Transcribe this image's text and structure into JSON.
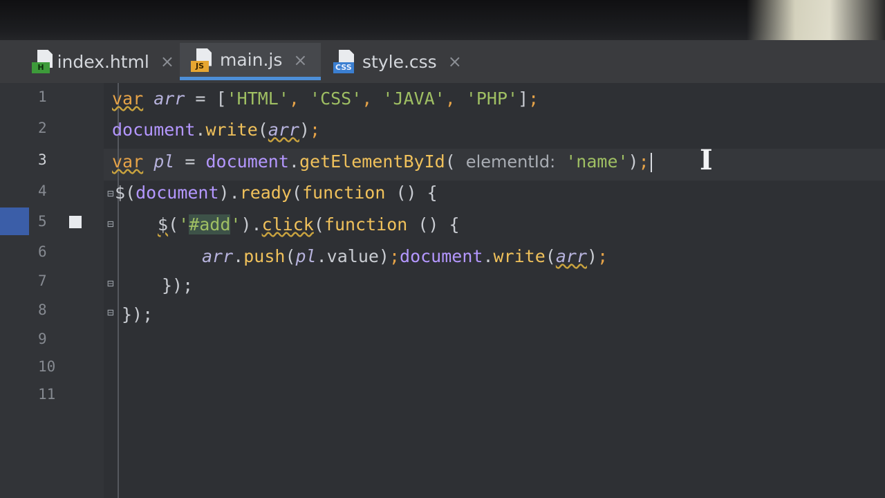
{
  "tabs": [
    {
      "label": "index.html",
      "badge": "H",
      "kind": "html"
    },
    {
      "label": "main.js",
      "badge": "JS",
      "kind": "js"
    },
    {
      "label": "style.css",
      "badge": "CSS",
      "kind": "css"
    }
  ],
  "close_glyph": "×",
  "active_tab": "main.js",
  "line_numbers": [
    "1",
    "2",
    "3",
    "4",
    "5",
    "6",
    "7",
    "8",
    "9",
    "10",
    "11"
  ],
  "current_line": "3",
  "code": {
    "l1": [
      "var",
      " ",
      "arr",
      " = [",
      "'HTML'",
      ", ",
      "'CSS'",
      ", ",
      "'JAVA'",
      ", ",
      "'PHP'",
      "]",
      ";"
    ],
    "l2": [
      "document",
      ".",
      "write",
      "(",
      "arr",
      ")",
      ";"
    ],
    "l3": [
      "var",
      " ",
      "pl",
      " = ",
      "document",
      ".",
      "getElementById",
      "( ",
      "elementId:",
      " ",
      "'name'",
      ")",
      ";"
    ],
    "l4": [
      "$",
      "(",
      "document",
      ").",
      "ready",
      "(",
      "function",
      " () {"
    ],
    "l5": [
      "$",
      "(",
      "'",
      "#add",
      "'",
      ").",
      "click",
      "(",
      "function",
      " () {"
    ],
    "l6": [
      "arr",
      ".",
      "push",
      "(",
      "pl",
      ".value)",
      ";",
      "document",
      ".",
      "write",
      "(",
      "arr",
      ")",
      ";"
    ],
    "l7": [
      "});"
    ],
    "l8": [
      "});"
    ]
  },
  "colors": {
    "keyword": "#e6a348",
    "string": "#9fbf63",
    "function": "#f0c15b",
    "object": "#b497ff",
    "tab_accent": "#4d8fd8"
  }
}
